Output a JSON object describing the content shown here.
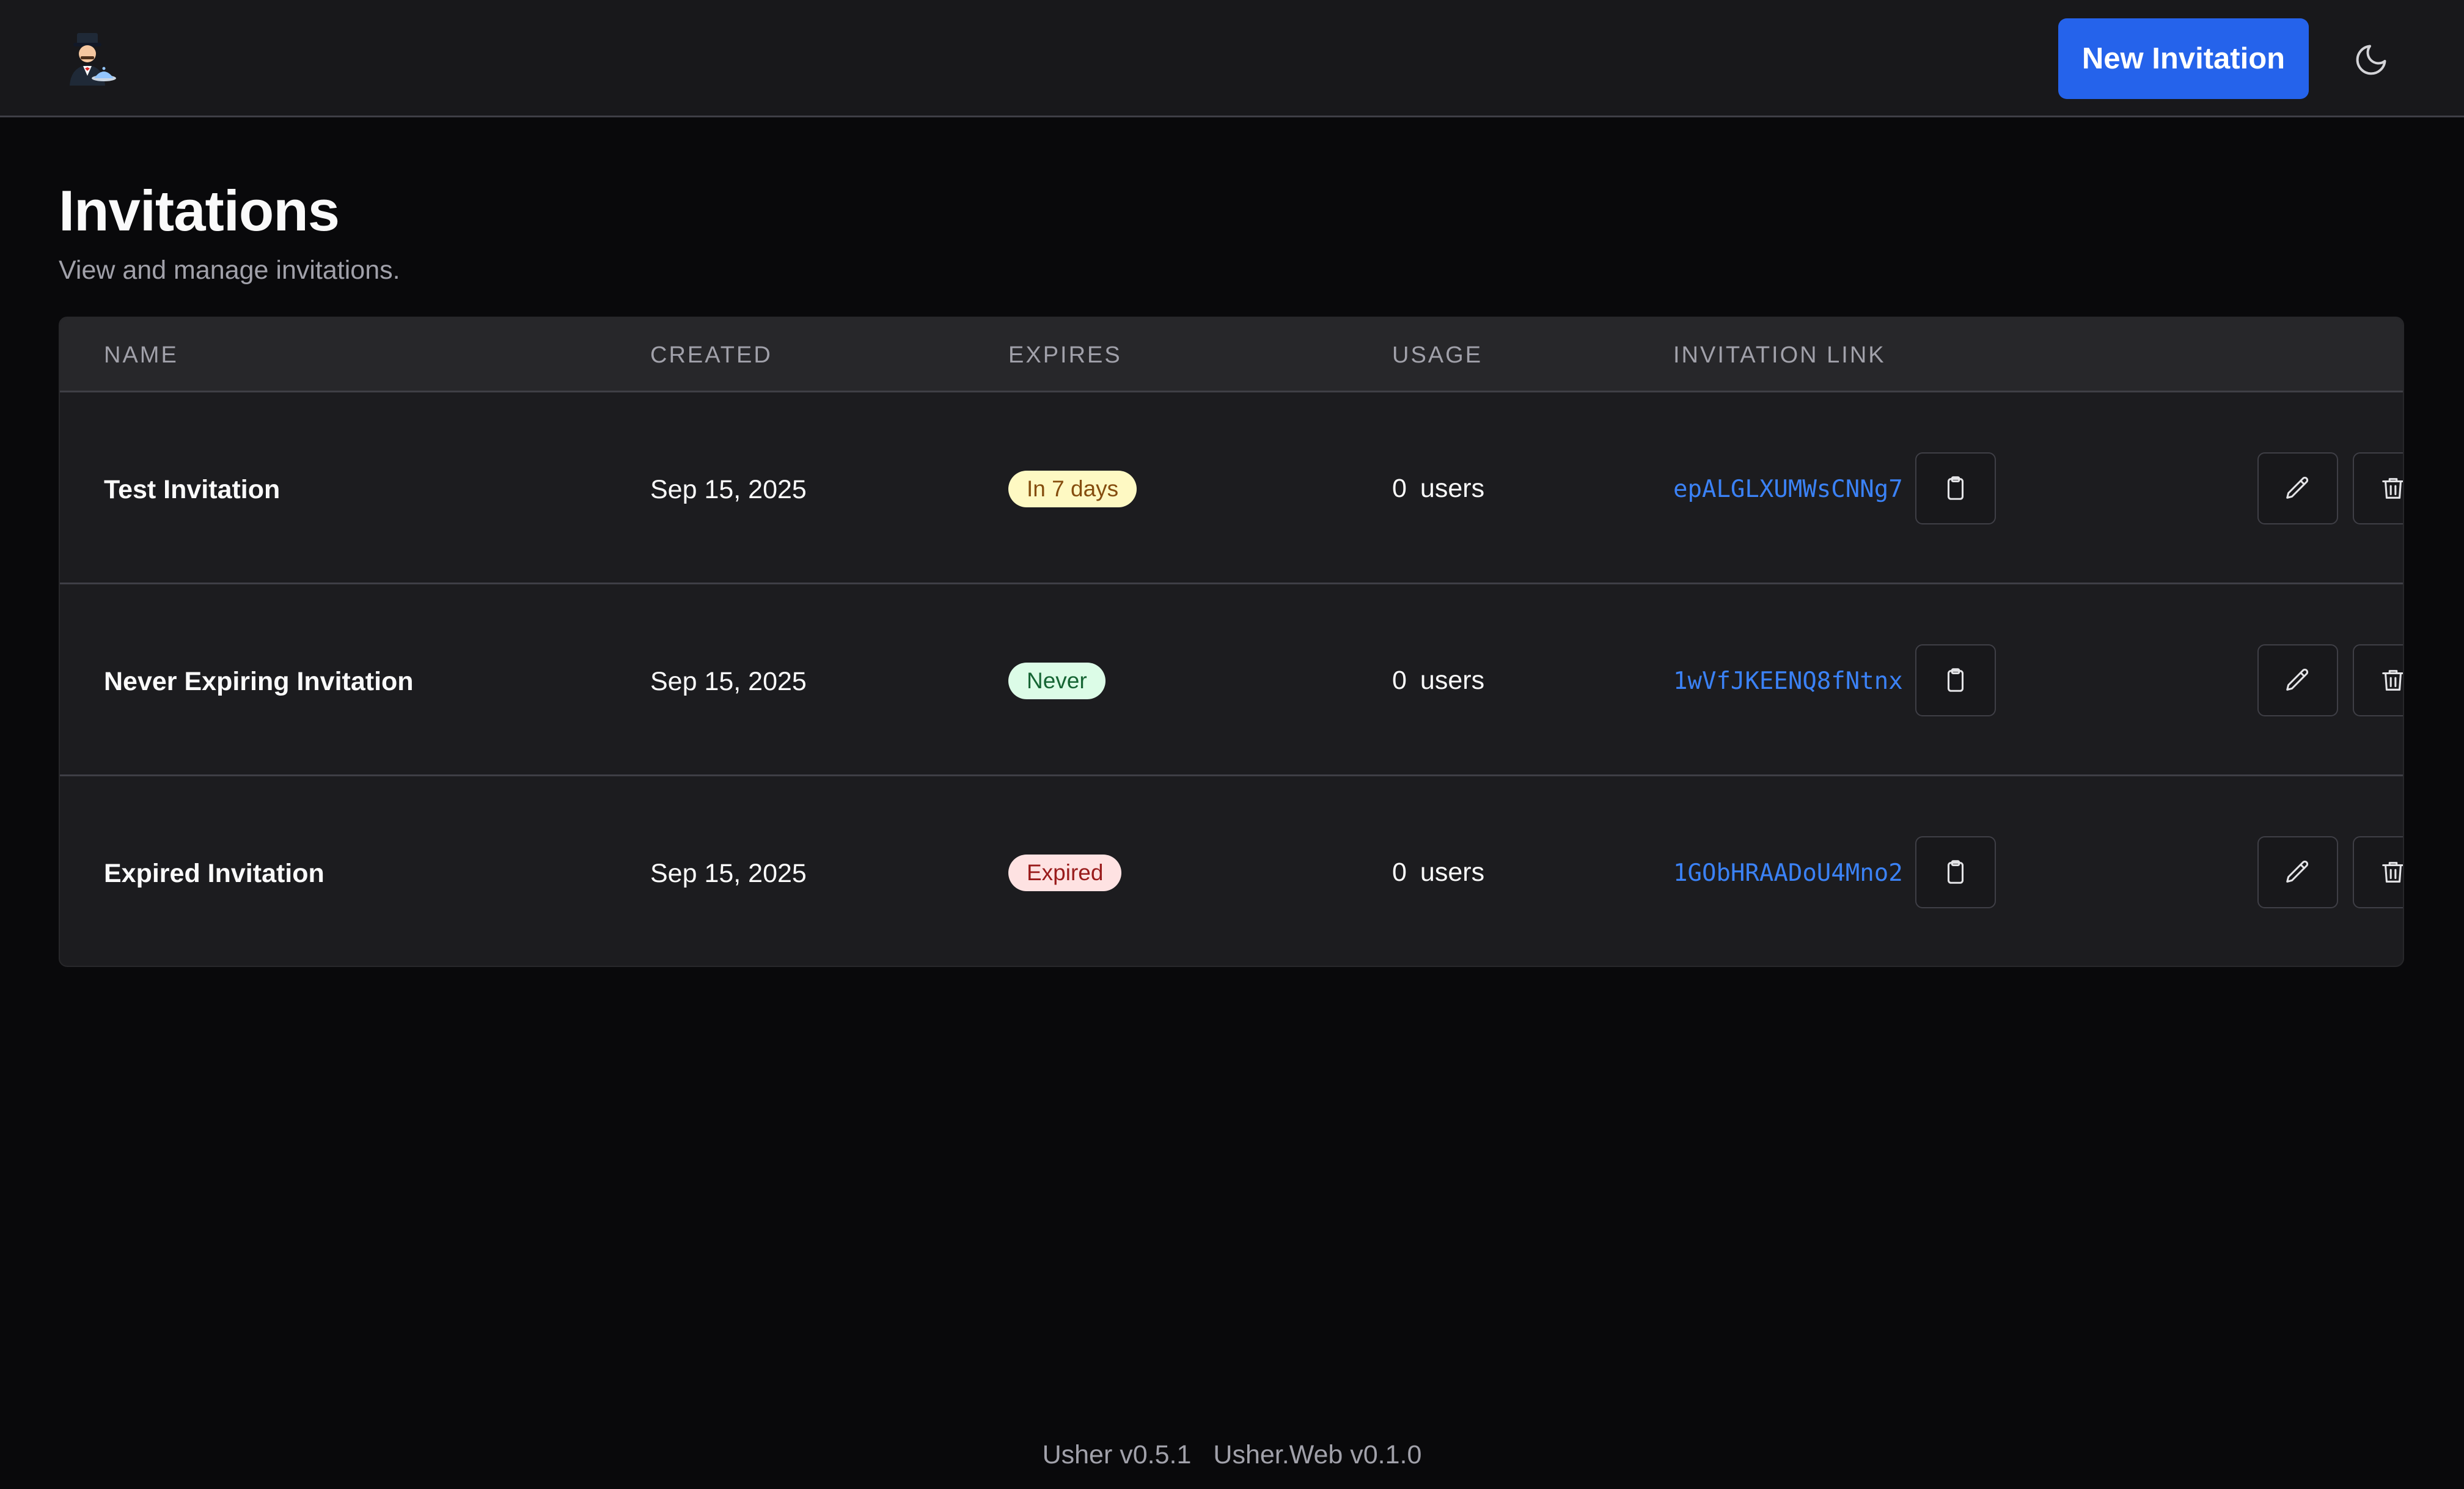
{
  "header": {
    "new_invitation_label": "New Invitation",
    "accent_color": "#2563eb"
  },
  "page": {
    "title": "Invitations",
    "subtitle": "View and manage invitations."
  },
  "table": {
    "columns": [
      "NAME",
      "CREATED",
      "EXPIRES",
      "USAGE",
      "INVITATION LINK"
    ],
    "rows": [
      {
        "name": "Test Invitation",
        "created": "Sep 15, 2025",
        "expires": "In 7 days",
        "expires_status": "warning",
        "usage_count": "0",
        "usage_unit": "users",
        "link_code": "epALGLXUMWsCNNg7"
      },
      {
        "name": "Never Expiring Invitation",
        "created": "Sep 15, 2025",
        "expires": "Never",
        "expires_status": "success",
        "usage_count": "0",
        "usage_unit": "users",
        "link_code": "1wVfJKEENQ8fNtnx"
      },
      {
        "name": "Expired Invitation",
        "created": "Sep 15, 2025",
        "expires": "Expired",
        "expires_status": "danger",
        "usage_count": "0",
        "usage_unit": "users",
        "link_code": "1GObHRAADoU4Mno2"
      }
    ],
    "row_icons": {
      "copy": "clipboard-icon",
      "edit": "pencil-icon",
      "delete": "trash-icon"
    }
  },
  "footer": {
    "usher_version": "Usher v0.5.1",
    "web_version": "Usher.Web v0.1.0"
  },
  "icons": {
    "logo": "butler-logo-icon",
    "theme": "moon-icon"
  },
  "colors": {
    "warning_bg": "#fef9c3",
    "success_bg": "#dcfce7",
    "danger_bg": "#fee2e2",
    "link": "#3b82f6"
  }
}
